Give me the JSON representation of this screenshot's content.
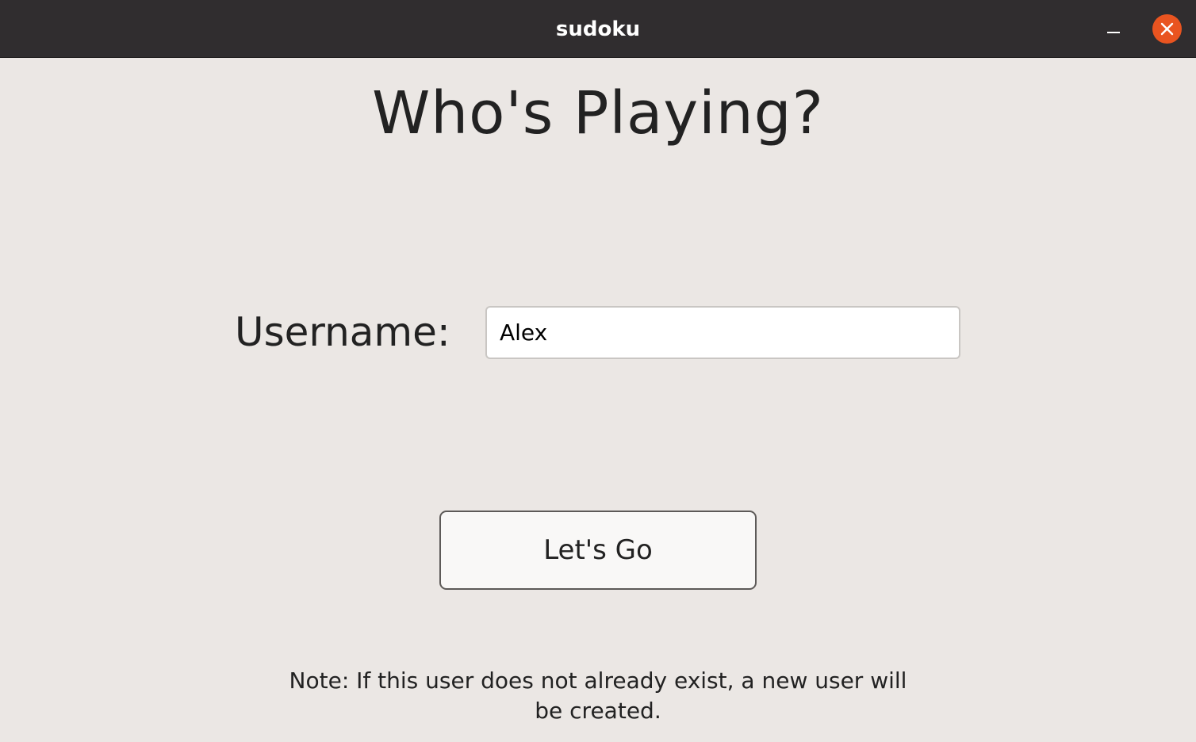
{
  "window": {
    "title": "sudoku"
  },
  "controls": {
    "minimize_icon": "minimize-icon",
    "close_icon": "close-icon",
    "close_color": "#e95420"
  },
  "main": {
    "heading": "Who's Playing?",
    "username_label": "Username:",
    "username_value": "Alex",
    "go_button_label": "Let's Go",
    "note": "Note: If this user does not already exist, a new user will be created."
  }
}
